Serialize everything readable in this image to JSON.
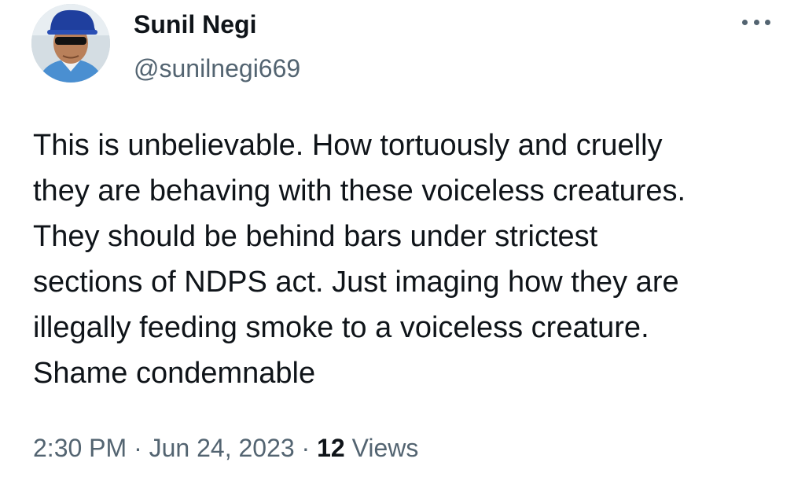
{
  "author": {
    "display_name": "Sunil Negi",
    "handle": "@sunilnegi669"
  },
  "menu": {
    "icon": "more-horizontal-icon"
  },
  "tweet": {
    "lines": [
      "This is unbelievable. How tortuously and cruelly",
      "they are behaving with these voiceless creatures.",
      "They should be behind bars under strictest",
      "sections of NDPS act. Just imaging how they are",
      "illegally feeding smoke to a voiceless creature.",
      "Shame condemnable"
    ]
  },
  "meta": {
    "time": "2:30 PM",
    "separator": "·",
    "date": "Jun 24, 2023",
    "views_count": "12",
    "views_label": "Views"
  },
  "colors": {
    "text": "#0f1419",
    "secondary": "#536471",
    "background": "#ffffff"
  }
}
